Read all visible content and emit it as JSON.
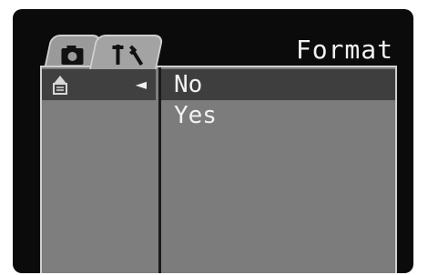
{
  "header": {
    "title": "Format",
    "tabs": [
      {
        "name": "camera-icon",
        "active": false
      },
      {
        "name": "setup-tools-icon",
        "active": true
      }
    ]
  },
  "sidebar": {
    "items": [
      {
        "icon": "format-card-icon",
        "arrow": "◄",
        "selected": true
      }
    ]
  },
  "menu": {
    "options": [
      {
        "label": "No",
        "selected": true
      },
      {
        "label": "Yes",
        "selected": false
      }
    ]
  },
  "colors": {
    "screen_bg": "#0b0b0b",
    "panel_bg": "#7c7c7c",
    "highlight": "#3e3e3e",
    "text": "#f2f2f2"
  }
}
